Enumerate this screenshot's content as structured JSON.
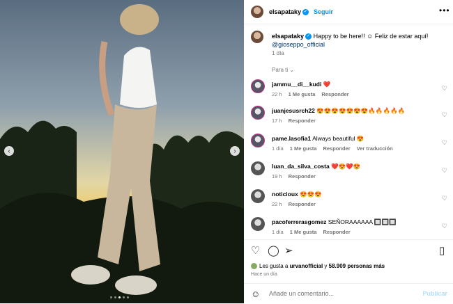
{
  "post": {
    "username": "elsapataky",
    "follow_label": "Seguir",
    "more_label": "•••",
    "caption_text": "Happy to be here!! ☺ Feliz de estar aquí!",
    "caption_mention": "@gioseppo_official",
    "caption_time": "1 día",
    "sort_label": "Para ti"
  },
  "comments": [
    {
      "user": "jammu__di__kudi",
      "text": "❤️",
      "time": "22 h",
      "likes": "1 Me gusta",
      "reply": "Responder",
      "translate": ""
    },
    {
      "user": "juanjesusrch22",
      "text": "😍😍😍😍😍😍😍🔥🔥🔥🔥🔥",
      "time": "17 h",
      "likes": "",
      "reply": "Responder",
      "translate": ""
    },
    {
      "user": "pame.lasofia1",
      "text": "Always beautiful 😍",
      "time": "1 día",
      "likes": "1 Me gusta",
      "reply": "Responder",
      "translate": "Ver traducción"
    },
    {
      "user": "luan_da_silva_costa",
      "text": "❤️😍❤️😍",
      "time": "19 h",
      "likes": "",
      "reply": "Responder",
      "translate": ""
    },
    {
      "user": "noticioux",
      "text": "😍😍😍",
      "time": "22 h",
      "likes": "",
      "reply": "Responder",
      "translate": ""
    },
    {
      "user": "pacoferrerasgomez",
      "text": "SEÑORAAAAAA 🔲🔲🔲",
      "time": "1 día",
      "likes": "1 Me gusta",
      "reply": "Responder",
      "translate": ""
    }
  ],
  "footer": {
    "likes_prefix": "Les gusta a ",
    "likes_user": "urvanofficial",
    "likes_mid": " y ",
    "likes_count": "58.909 personas más",
    "ago": "Hace un día",
    "comment_placeholder": "Añade un comentario...",
    "publish_label": "Publicar"
  },
  "icons": {
    "prev": "chevron-left-icon",
    "next": "chevron-right-icon",
    "like": "heart-icon",
    "comment": "comment-icon",
    "share": "send-icon",
    "save": "bookmark-icon",
    "emoji": "emoji-icon"
  },
  "colors": {
    "accent": "#0095f6",
    "link": "#00376b",
    "muted": "#737373"
  }
}
